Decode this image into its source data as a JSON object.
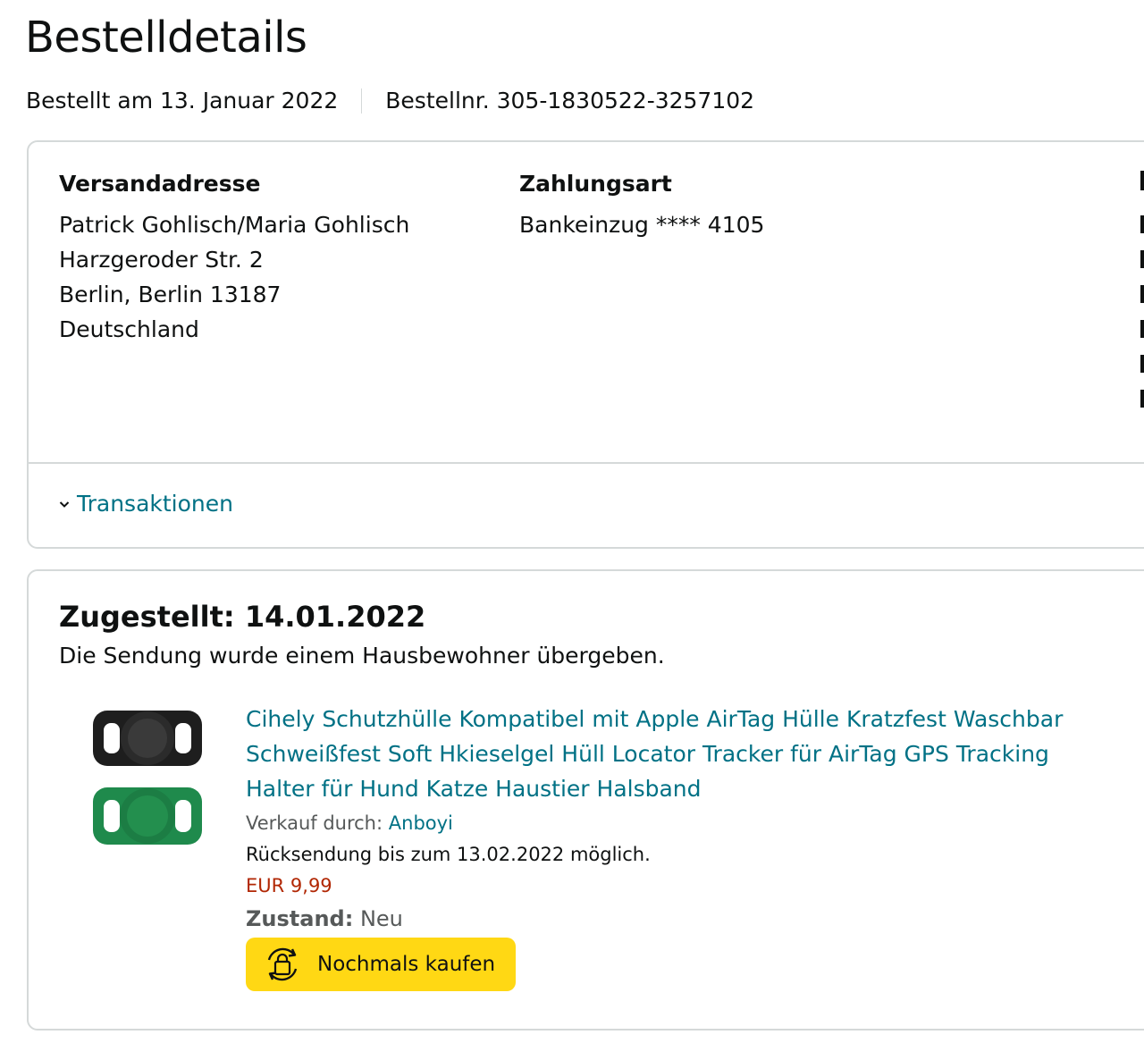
{
  "page": {
    "title": "Bestelldetails",
    "order_date": "Bestellt am 13. Januar 2022",
    "order_number": "Bestellnr. 305-1830522-3257102"
  },
  "summary": {
    "shipping": {
      "heading": "Versandadresse",
      "lines": [
        "Patrick Gohlisch/Maria Gohlisch",
        "Harzgeroder Str. 2",
        "Berlin, Berlin 13187",
        "Deutschland"
      ]
    },
    "payment": {
      "heading": "Zahlungsart",
      "method": "Bankeinzug **** 4105"
    },
    "transactions_link": "Transaktionen"
  },
  "shipment": {
    "status": "Zugestellt: 14.01.2022",
    "note": "Die Sendung wurde einem Hausbewohner übergeben.",
    "item": {
      "title": "Cihely Schutzhülle Kompatibel mit Apple AirTag Hülle Kratzfest Waschbar Schweißfest Soft Hkieselgel Hüll Locator Tracker für AirTag GPS Tracking Halter für Hund Katze Haustier Halsband",
      "seller_label": "Verkauf durch:",
      "seller_name": "Anboyi",
      "return_info": "Rücksendung bis zum 13.02.2022 möglich.",
      "price": "EUR 9,99",
      "condition_label": "Zustand:",
      "condition_value": "Neu",
      "buy_again_label": "Nochmals kaufen",
      "image_icon": "airtag-holder-product-image"
    }
  },
  "colors": {
    "link": "#007185",
    "price": "#b12704",
    "button": "#ffd814",
    "border": "#d5d9d9"
  }
}
